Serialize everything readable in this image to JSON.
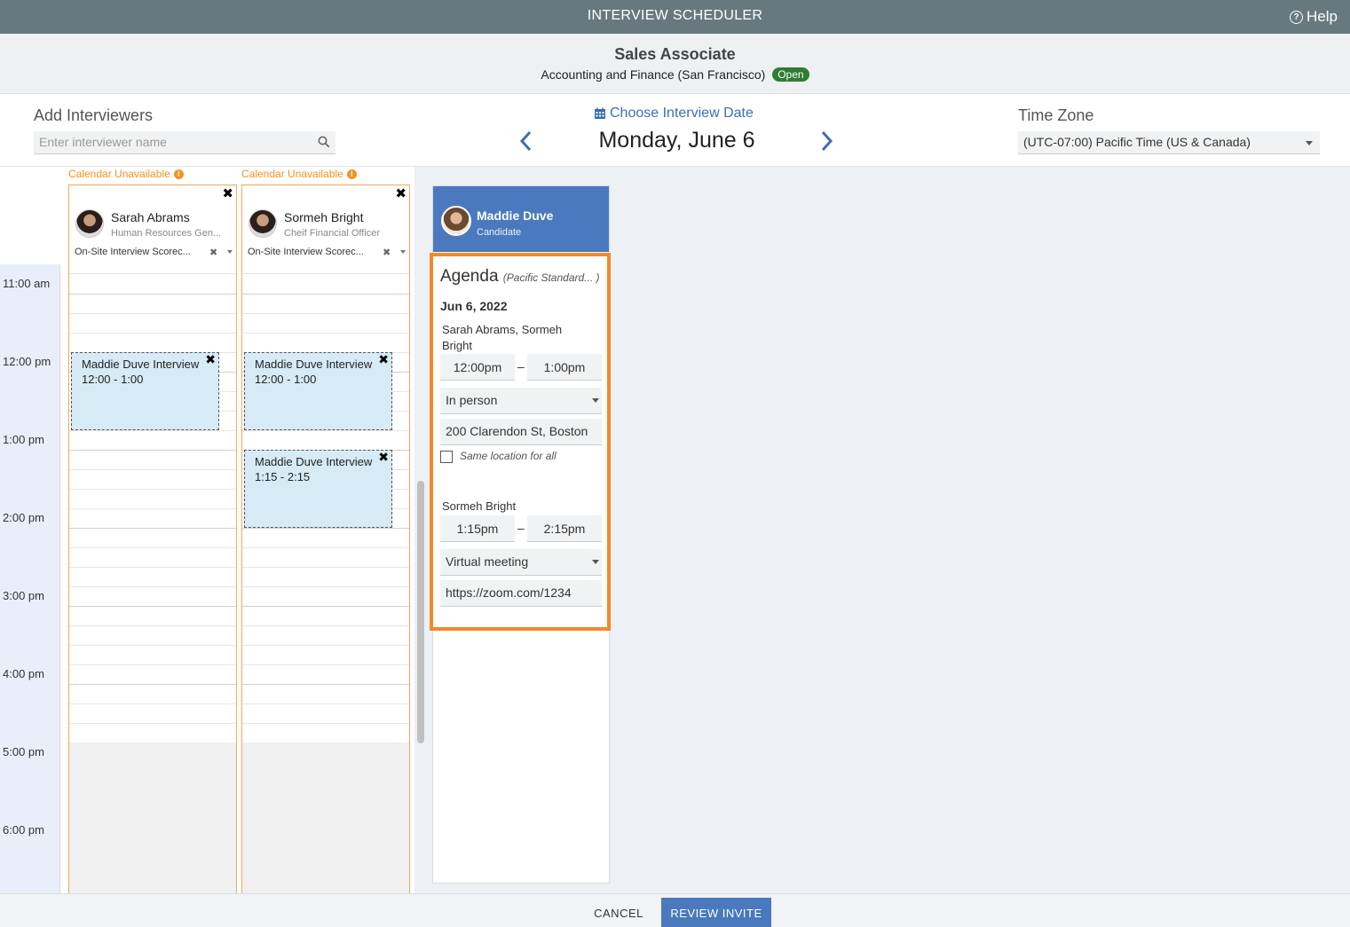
{
  "app": {
    "title": "INTERVIEW SCHEDULER",
    "help_label": "Help"
  },
  "job": {
    "title": "Sales Associate",
    "department": "Accounting and Finance (San Francisco)",
    "status": "Open"
  },
  "interviewers": {
    "label": "Add Interviewers",
    "search_placeholder": "Enter interviewer name"
  },
  "date": {
    "choose_label": "Choose Interview Date",
    "current": "Monday, June 6"
  },
  "timezone": {
    "label": "Time Zone",
    "selected": "(UTC-07:00) Pacific Time (US & Canada)"
  },
  "time_slots": [
    "11:00 am",
    "12:00 pm",
    "1:00 pm",
    "2:00 pm",
    "3:00 pm",
    "4:00 pm",
    "5:00 pm",
    "6:00 pm"
  ],
  "columns": [
    {
      "unavailable_label": "Calendar Unavailable",
      "name": "Sarah Abrams",
      "role": "Human Resources Gen...",
      "scorecard": "On-Site Interview Scorec...",
      "events": [
        {
          "title": "Maddie Duve Interview",
          "time": "12:00 - 1:00"
        }
      ]
    },
    {
      "unavailable_label": "Calendar Unavailable",
      "name": "Sormeh Bright",
      "role": "Cheif Financial Officer",
      "scorecard": "On-Site Interview Scorec...",
      "events": [
        {
          "title": "Maddie Duve Interview",
          "time": "12:00 - 1:00"
        },
        {
          "title": "Maddie Duve Interview",
          "time": "1:15 - 2:15"
        }
      ]
    }
  ],
  "candidate": {
    "name": "Maddie Duve",
    "role": "Candidate"
  },
  "agenda": {
    "title": "Agenda",
    "timezone": "(Pacific Standard... )",
    "date": "Jun 6, 2022",
    "items": [
      {
        "interviewers": "Sarah Abrams, Sormeh Bright",
        "start": "12:00pm",
        "end": "1:00pm",
        "dash": "–",
        "type": "In person",
        "location": "200 Clarendon St, Boston"
      },
      {
        "interviewers": "Sormeh Bright",
        "start": "1:15pm",
        "end": "2:15pm",
        "dash": "–",
        "type": "Virtual meeting",
        "location": "https://zoom.com/1234"
      }
    ],
    "same_location_label": "Same location for all"
  },
  "footer": {
    "cancel": "CANCEL",
    "review": "REVIEW INVITE"
  },
  "colors": {
    "header_bg": "#67797f",
    "accent_blue": "#4a79bd",
    "open_badge": "#2e7d32",
    "warning_orange": "#f39221",
    "highlight_border": "#f3892a",
    "event_bg": "#d6ebf5"
  },
  "icons": {
    "help": "help-icon",
    "search": "search-icon",
    "calendar": "calendar-icon",
    "prev": "chevron-left-icon",
    "next": "chevron-right-icon",
    "info": "info-icon",
    "close": "close-icon"
  }
}
